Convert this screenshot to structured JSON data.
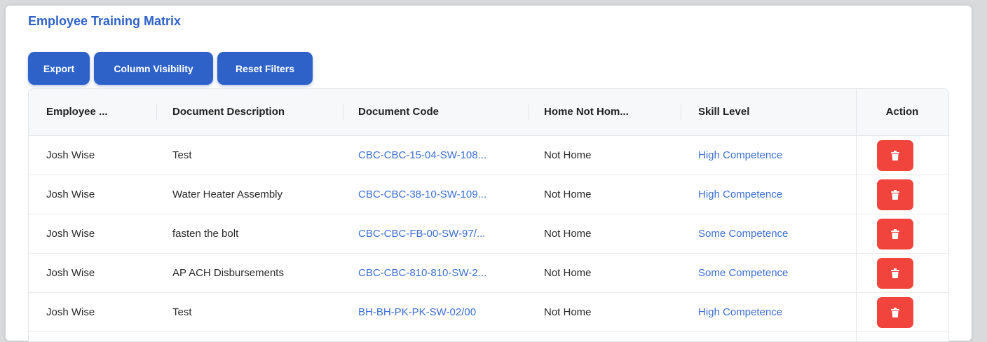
{
  "page": {
    "title": "Employee Training Matrix"
  },
  "toolbar": {
    "export_label": "Export",
    "column_visibility_label": "Column Visibility",
    "reset_filters_label": "Reset Filters"
  },
  "table": {
    "columns": [
      "Employee ...",
      "Document Description",
      "Document Code",
      "Home Not Hom...",
      "Skill Level",
      "Action"
    ],
    "rows": [
      {
        "employee": "Josh Wise",
        "description": "Test",
        "code": "CBC-CBC-15-04-SW-108...",
        "home": "Not Home",
        "skill": "High Competence"
      },
      {
        "employee": "Josh Wise",
        "description": "Water Heater Assembly",
        "code": "CBC-CBC-38-10-SW-109...",
        "home": "Not Home",
        "skill": "High Competence"
      },
      {
        "employee": "Josh Wise",
        "description": "fasten the bolt",
        "code": "CBC-CBC-FB-00-SW-97/...",
        "home": "Not Home",
        "skill": "Some Competence"
      },
      {
        "employee": "Josh Wise",
        "description": "AP ACH Disbursements",
        "code": "CBC-CBC-810-810-SW-2...",
        "home": "Not Home",
        "skill": "Some Competence"
      },
      {
        "employee": "Josh Wise",
        "description": "Test",
        "code": "BH-BH-PK-PK-SW-02/00",
        "home": "Not Home",
        "skill": "High Competence"
      }
    ],
    "action_icon": "trash-icon"
  },
  "colors": {
    "primary": "#2f62c8",
    "link": "#3d6fd4",
    "danger": "#f0443d"
  }
}
